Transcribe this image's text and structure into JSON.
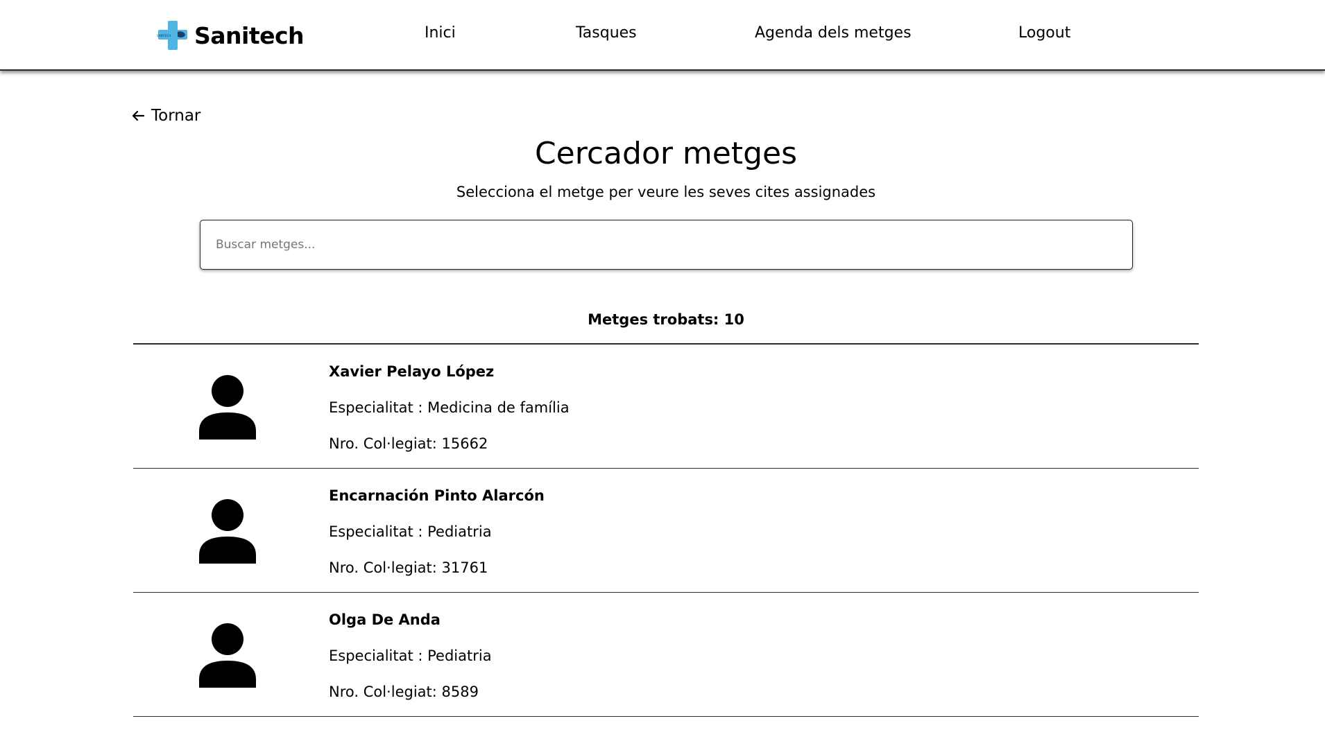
{
  "header": {
    "brand_name": "Sanitech",
    "brand_mark_text": "SANITECH",
    "nav": [
      {
        "label": "Inici"
      },
      {
        "label": "Tasques"
      },
      {
        "label": "Agenda dels metges"
      },
      {
        "label": "Logout"
      }
    ]
  },
  "back": {
    "label": "Tornar",
    "icon": "arrow-left-icon"
  },
  "page": {
    "title": "Cercador metges",
    "subtitle": "Selecciona el metge per veure les seves cites assignades"
  },
  "search": {
    "placeholder": "Buscar metges...",
    "value": ""
  },
  "results": {
    "count_label": "Metges trobats: 10",
    "doctors": [
      {
        "name": "Xavier Pelayo López",
        "specialty": "Especialitat : Medicina de família",
        "license": "Nro. Col·legiat: 15662"
      },
      {
        "name": "Encarnación Pinto Alarcón",
        "specialty": "Especialitat : Pediatria",
        "license": "Nro. Col·legiat: 31761"
      },
      {
        "name": "Olga De Anda",
        "specialty": "Especialitat : Pediatria",
        "license": "Nro. Col·legiat: 8589"
      }
    ]
  },
  "colors": {
    "brand_cross": "#4fb6e3",
    "text": "#000000",
    "divider": "#2b2b2b"
  }
}
